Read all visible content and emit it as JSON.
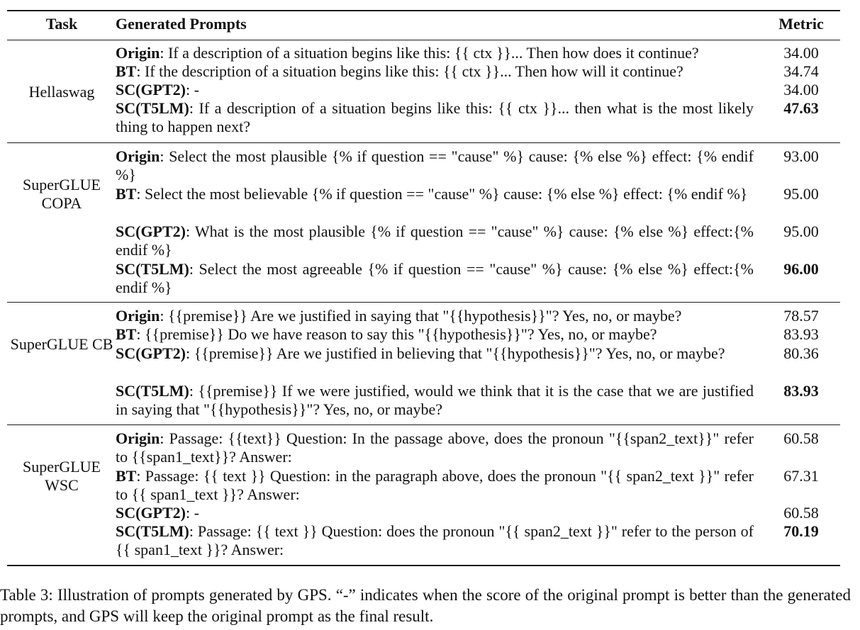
{
  "table": {
    "headers": {
      "task": "Task",
      "prompts": "Generated Prompts",
      "metric": "Metric"
    },
    "groups": [
      {
        "task": "Hellaswag",
        "rows": [
          {
            "label": "Origin",
            "text": ": If a description of a situation begins like this: {{ ctx }}... Then how does it continue?",
            "metric": "34.00",
            "best": false
          },
          {
            "label": "BT",
            "text": ": If the description of a situation begins like this: {{ ctx }}... Then how will it continue?",
            "metric": "34.74",
            "best": false
          },
          {
            "label": "SC(GPT2)",
            "text": ": -",
            "metric": "34.00",
            "best": false
          },
          {
            "label": "SC(T5LM)",
            "text": ": If a description of a situation begins like this: {{ ctx }}... then what is the most likely thing to happen next?",
            "metric": "47.63",
            "best": true
          }
        ]
      },
      {
        "task": "SuperGLUE COPA",
        "rows": [
          {
            "label": "Origin",
            "text": ": Select the most plausible {% if question == \"cause\" %} cause: {% else %} effect: {% endif %}",
            "metric": "93.00",
            "best": false
          },
          {
            "label": "BT",
            "text": ": Select the most believable {% if question == \"cause\" %} cause: {% else %} effect: {% endif %}",
            "metric": "95.00",
            "best": false
          },
          {
            "label": "SC(GPT2)",
            "text": ": What is the most plausible {% if question == \"cause\" %} cause: {% else %} effect:{% endif %}",
            "metric": "95.00",
            "best": false
          },
          {
            "label": "SC(T5LM)",
            "text": ": Select the most agreeable {% if question == \"cause\" %} cause: {% else %} effect:{% endif %}",
            "metric": "96.00",
            "best": true
          }
        ]
      },
      {
        "task": "SuperGLUE CB",
        "rows": [
          {
            "label": "Origin",
            "text": ": {{premise}} Are we justified in saying that \"{{hypothesis}}\"? Yes, no, or maybe?",
            "metric": "78.57",
            "best": false
          },
          {
            "label": "BT",
            "text": ": {{premise}} Do we have reason to say this \"{{hypothesis}}\"? Yes, no, or maybe?",
            "metric": "83.93",
            "best": false
          },
          {
            "label": "SC(GPT2)",
            "text": ": {{premise}} Are we justified in believing that \"{{hypothesis}}\"? Yes, no, or maybe?",
            "metric": "80.36",
            "best": false
          },
          {
            "label": "SC(T5LM)",
            "text": ": {{premise}} If we were justified, would we think that it is the case that we are justified in saying that \"{{hypothesis}}\"? Yes, no, or maybe?",
            "metric": "83.93",
            "best": true
          }
        ]
      },
      {
        "task": "SuperGLUE WSC",
        "rows": [
          {
            "label": "Origin",
            "text": ": Passage: {{text}} Question: In the passage above, does the pronoun \"{{span2_text}}\" refer to {{span1_text}}? Answer:",
            "metric": "60.58",
            "best": false
          },
          {
            "label": "BT",
            "text": ": Passage: {{ text }} Question: in the paragraph above, does the pronoun \"{{ span2_text }}\" refer to {{ span1_text }}? Answer:",
            "metric": "67.31",
            "best": false
          },
          {
            "label": "SC(GPT2)",
            "text": ": -",
            "metric": "60.58",
            "best": false
          },
          {
            "label": "SC(T5LM)",
            "text": ": Passage: {{ text }} Question: does the pronoun \"{{ span2_text }}\" refer to the person of {{ span1_text }}? Answer:",
            "metric": "70.19",
            "best": true
          }
        ]
      }
    ]
  },
  "caption": "Table 3: Illustration of prompts generated by GPS. “-” indicates when the score of the original prompt is better than the generated prompts, and GPS will keep the original prompt as the final result."
}
